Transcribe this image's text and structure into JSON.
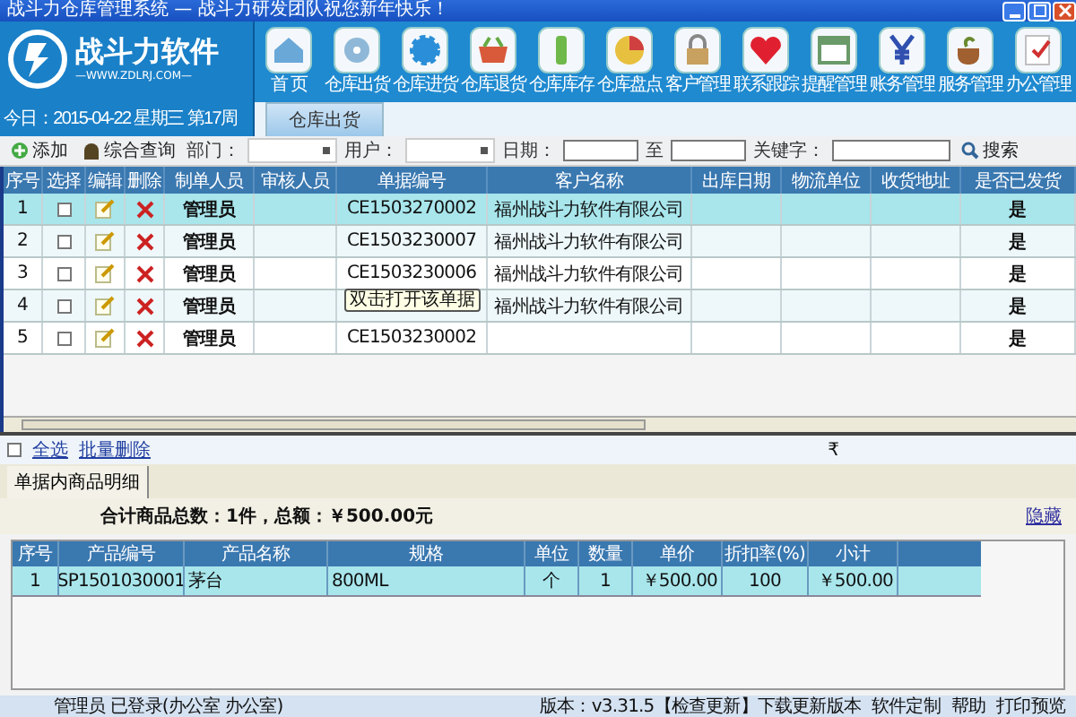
{
  "window": {
    "title": "战斗力仓库管理系统 — 战斗力研发团队祝您新年快乐！"
  },
  "logo": {
    "name": "战斗力软件",
    "url": "—WWW.ZDLRJ.COM—"
  },
  "nav": [
    {
      "label": "首 页"
    },
    {
      "label": "仓库出货"
    },
    {
      "label": "仓库进货"
    },
    {
      "label": "仓库退货"
    },
    {
      "label": "仓库库存"
    },
    {
      "label": "仓库盘点"
    },
    {
      "label": "客户管理"
    },
    {
      "label": "联系跟踪"
    },
    {
      "label": "提醒管理"
    },
    {
      "label": "账务管理"
    },
    {
      "label": "服务管理"
    },
    {
      "label": "办公管理"
    }
  ],
  "date_line": "今日：2015-04-22  星期三  第17周",
  "tabs": [
    {
      "label": "仓库出货",
      "selected": true
    }
  ],
  "toolbar": {
    "add": "添加",
    "query": "综合查询",
    "dept_label": "部门：",
    "user_label": "用户：",
    "date_label": "日期：",
    "to_label": "至",
    "keyword_label": "关键字：",
    "search": "搜索"
  },
  "table": {
    "columns": [
      "序号",
      "选择",
      "编辑",
      "删除",
      "制单人员",
      "审核人员",
      "单据编号",
      "客户名称",
      "出库日期",
      "物流单位",
      "收货地址",
      "是否已发货"
    ],
    "rows": [
      {
        "no": "1",
        "checked": false,
        "selected": true,
        "maker": "管理员",
        "doc": "CE1503270002",
        "customer": "福州战斗力软件有限公司",
        "shipped": "是"
      },
      {
        "no": "2",
        "checked": false,
        "selected": false,
        "maker": "管理员",
        "doc": "CE1503230007",
        "customer": "福州战斗力软件有限公司",
        "shipped": "是"
      },
      {
        "no": "3",
        "checked": false,
        "selected": false,
        "maker": "管理员",
        "doc": "CE1503230006",
        "customer": "福州战斗力软件有限公司",
        "shipped": "是"
      },
      {
        "no": "4",
        "checked": false,
        "selected": false,
        "maker": "管理员",
        "customer": "福州战斗力软件有限公司",
        "shipped": "是"
      },
      {
        "no": "5",
        "checked": false,
        "selected": false,
        "maker": "管理员",
        "doc": "CE1503230002",
        "shipped": "是"
      }
    ]
  },
  "tooltip": "双击打开该单据",
  "bulk": {
    "checked": false,
    "select_all": "全选",
    "batch_delete": "批量删除",
    "mark": "₹"
  },
  "detail_tabs": [
    {
      "label": "单据内商品明细",
      "selected": true
    }
  ],
  "summary": "合计商品总数：1件，总额：￥500.00元",
  "hide": "隐藏",
  "items": {
    "columns": [
      "序号",
      "产品编号",
      "产品名称",
      "规格",
      "单位",
      "数量",
      "单价",
      "折扣率(%)",
      "小计"
    ],
    "rows": [
      {
        "cells": [
          "1",
          "SP1501030001",
          "茅台",
          "800ML",
          "个",
          "1",
          "￥500.00",
          "100",
          "￥500.00"
        ]
      }
    ]
  },
  "status_bar": {
    "user": "管理员 已登录(办公室 办公室)",
    "version": "版本：v3.31.5【检查更新】下载更新版本",
    "custom": "软件定制",
    "help": "帮助",
    "print": "打印预览"
  }
}
